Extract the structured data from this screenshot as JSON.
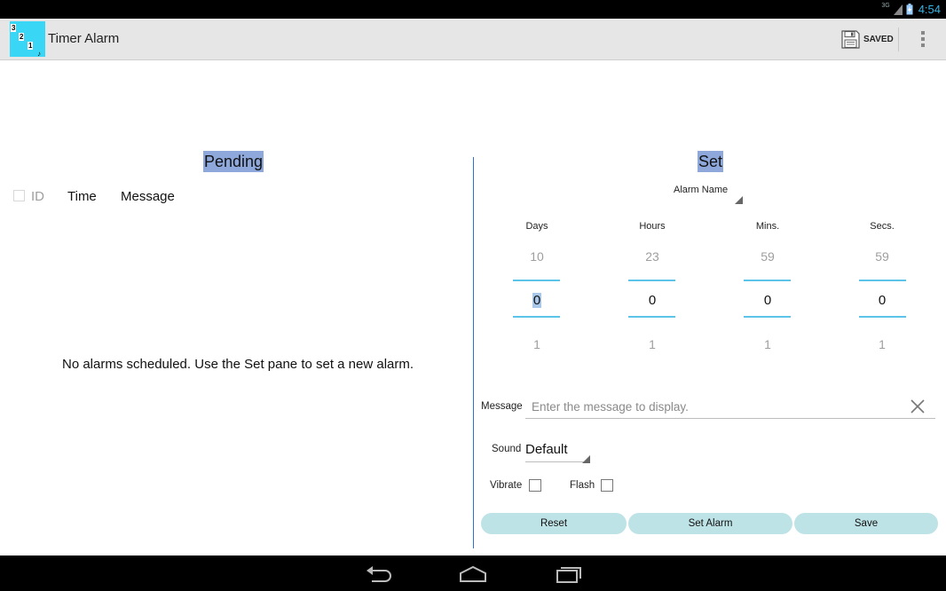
{
  "status_bar": {
    "network": "3G",
    "time": "4:54"
  },
  "action_bar": {
    "app_icon_digits": [
      "3",
      "2",
      "1",
      "♪"
    ],
    "title": "Timer Alarm",
    "saved_label": "SAVED"
  },
  "pending": {
    "title": "Pending",
    "columns": [
      "ID",
      "Time",
      "Message"
    ],
    "empty_message": "No alarms scheduled. Use the Set pane to set a new alarm."
  },
  "set": {
    "title": "Set",
    "alarm_name_label": "Alarm Name",
    "pickers": [
      {
        "label": "Days",
        "prev": "10",
        "value": "0",
        "next": "1"
      },
      {
        "label": "Hours",
        "prev": "23",
        "value": "0",
        "next": "1"
      },
      {
        "label": "Mins.",
        "prev": "59",
        "value": "0",
        "next": "1"
      },
      {
        "label": "Secs.",
        "prev": "59",
        "value": "0",
        "next": "1"
      }
    ],
    "message_label": "Message",
    "message_placeholder": "Enter the message to display.",
    "message_value": "",
    "sound_label": "Sound",
    "sound_value": "Default",
    "vibrate_label": "Vibrate",
    "vibrate_checked": false,
    "flash_label": "Flash",
    "flash_checked": false,
    "buttons": {
      "reset": "Reset",
      "set_alarm": "Set Alarm",
      "save": "Save"
    }
  },
  "colors": {
    "accent": "#33b5e5",
    "picker_line": "#5bc4e8",
    "title_highlight": "#8ea8dc",
    "button_bg": "#bee3e6",
    "divider": "#2f6fd1",
    "app_icon": "#3ad6f5"
  }
}
